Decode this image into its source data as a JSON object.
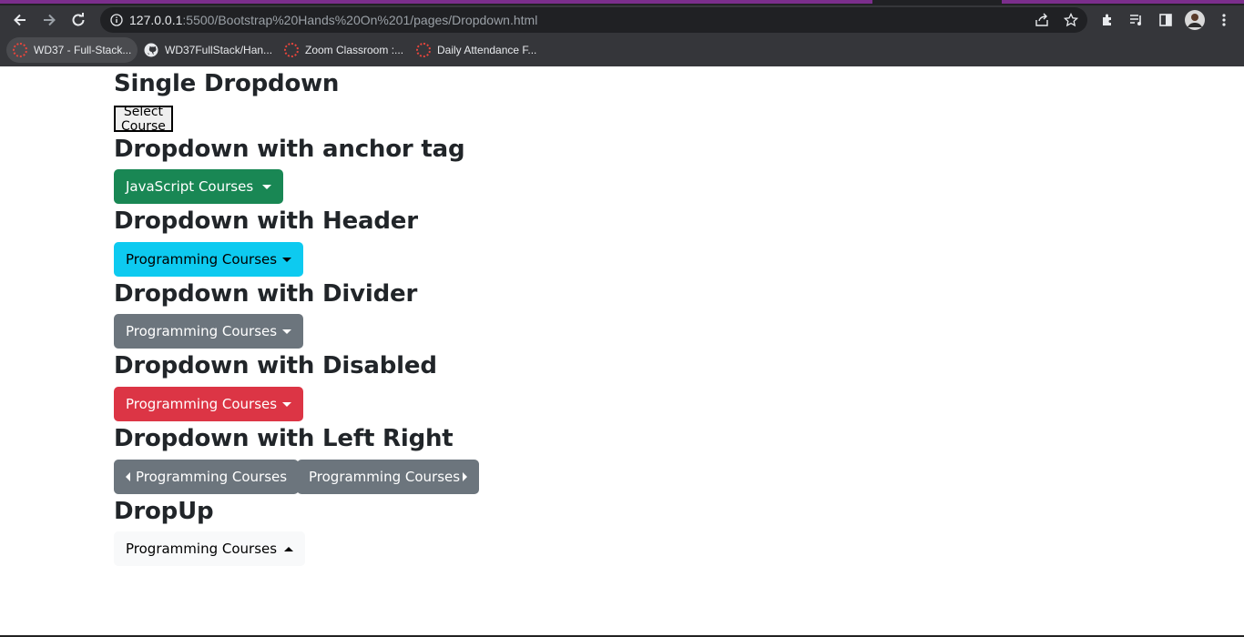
{
  "browser": {
    "url_host": "127.0.0.1",
    "url_path": ":5500/Bootstrap%20Hands%20On%201/pages/Dropdown.html",
    "bookmarks": [
      {
        "label": "WD37 - Full-Stack..."
      },
      {
        "label": "WD37FullStack/Han..."
      },
      {
        "label": "Zoom Classroom :..."
      },
      {
        "label": "Daily Attendance F..."
      }
    ]
  },
  "sections": {
    "single": {
      "heading": "Single Dropdown",
      "button": "Select Course"
    },
    "anchor": {
      "heading": "Dropdown with anchor tag",
      "button": "JavaScript Courses"
    },
    "header": {
      "heading": "Dropdown with Header",
      "button": "Programming Courses"
    },
    "divider": {
      "heading": "Dropdown with Divider",
      "button": "Programming Courses"
    },
    "disabled": {
      "heading": "Dropdown with Disabled",
      "button": "Programming Courses"
    },
    "leftright": {
      "heading": "Dropdown with Left Right",
      "left_button": "Programming Courses",
      "right_button": "Programming Courses"
    },
    "dropup": {
      "heading": "DropUp",
      "button": "Programming Courses"
    }
  },
  "colors": {
    "success": "#198754",
    "info": "#0dcaf0",
    "secondary": "#6c757d",
    "danger": "#dc3545",
    "light": "#f8f9fa"
  }
}
